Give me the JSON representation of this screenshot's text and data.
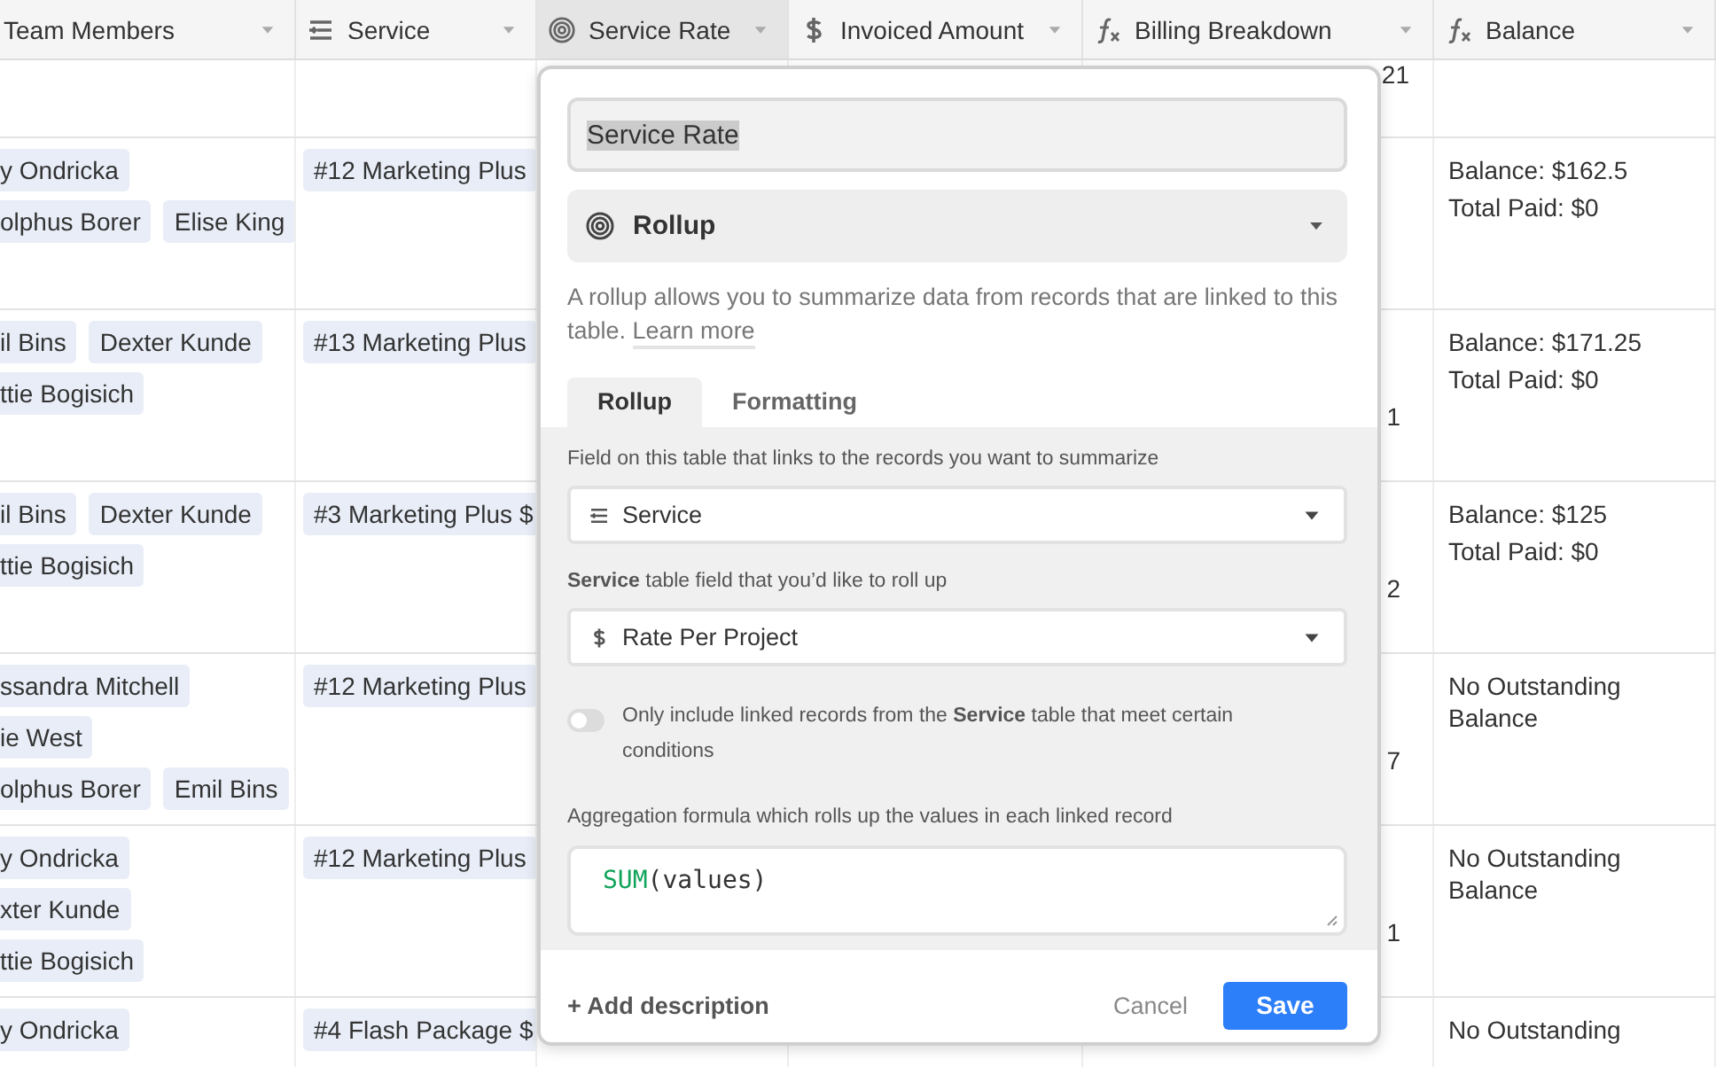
{
  "columns": [
    {
      "label": "Team Members",
      "kind": "none",
      "selected": false
    },
    {
      "label": "Service",
      "kind": "lookup",
      "selected": false
    },
    {
      "label": "Service Rate",
      "kind": "rollup",
      "selected": true
    },
    {
      "label": "Invoiced Amount",
      "kind": "currency",
      "selected": false
    },
    {
      "label": "Billing Breakdown",
      "kind": "formula",
      "selected": false
    },
    {
      "label": "Balance",
      "kind": "formula",
      "selected": false
    }
  ],
  "rows": [
    {
      "team_members": [],
      "service": [],
      "billing_breakdown": [
        "21"
      ],
      "balance": []
    },
    {
      "team_members": [
        [
          "y Ondricka"
        ],
        [
          "olphus Borer",
          "Elise King"
        ]
      ],
      "service": [
        "#12 Marketing Plus"
      ],
      "billing_breakdown": [],
      "balance": [
        "Balance: $162.5",
        "Total Paid: $0"
      ]
    },
    {
      "team_members": [
        [
          "il Bins",
          "Dexter Kunde"
        ],
        [
          "ttie Bogisich"
        ]
      ],
      "service": [
        "#13 Marketing Plus"
      ],
      "billing_breakdown": [
        "1"
      ],
      "balance": [
        "Balance: $171.25",
        "Total Paid: $0"
      ]
    },
    {
      "team_members": [
        [
          "il Bins",
          "Dexter Kunde"
        ],
        [
          "ttie Bogisich"
        ]
      ],
      "service": [
        "#3 Marketing Plus $"
      ],
      "billing_breakdown": [
        "2"
      ],
      "balance": [
        "Balance: $125",
        "Total Paid: $0"
      ]
    },
    {
      "team_members": [
        [
          "ssandra Mitchell"
        ],
        [
          "ie West"
        ],
        [
          "olphus Borer",
          "Emil Bins"
        ]
      ],
      "service": [
        "#12 Marketing Plus"
      ],
      "billing_breakdown": [
        "7"
      ],
      "balance": [
        "No Outstanding Balance"
      ]
    },
    {
      "team_members": [
        [
          "y Ondricka"
        ],
        [
          "xter Kunde"
        ],
        [
          "ttie Bogisich"
        ]
      ],
      "service": [
        "#12 Marketing Plus"
      ],
      "billing_breakdown": [
        "1"
      ],
      "balance": [
        "No Outstanding Balance"
      ]
    },
    {
      "team_members": [
        [
          "y Ondricka"
        ]
      ],
      "service": [
        "#4 Flash Package $"
      ],
      "billing_breakdown": [],
      "balance": [
        "No Outstanding"
      ]
    }
  ],
  "popup": {
    "name_field": {
      "value": "Service Rate",
      "text_selected": true
    },
    "field_type": {
      "label": "Rollup",
      "kind": "rollup"
    },
    "description": "A rollup allows you to summarize data from records that are linked to this table.",
    "learn_more": "Learn more",
    "tabs": [
      {
        "label": "Rollup",
        "selected": true
      },
      {
        "label": "Formatting",
        "selected": false
      }
    ],
    "link_field": {
      "label": "Field on this table that links to the records you want to summarize",
      "value": "Service",
      "kind": "lookup"
    },
    "rollup_field": {
      "label": "**Service** table field that you’d like to roll up",
      "value": "Rate Per Project",
      "kind": "currency"
    },
    "filter_toggle": {
      "on": false,
      "label": "Only include linked records from the **Service** table that meet certain conditions"
    },
    "formula": {
      "label": "Aggregation formula which rolls up the values in each linked record",
      "tokens": [
        {
          "text": "SUM",
          "kind": "function"
        },
        {
          "text": "(values)",
          "kind": "plain"
        }
      ]
    },
    "add_description": "+ Add description",
    "cancel": "Cancel",
    "save": "Save"
  }
}
